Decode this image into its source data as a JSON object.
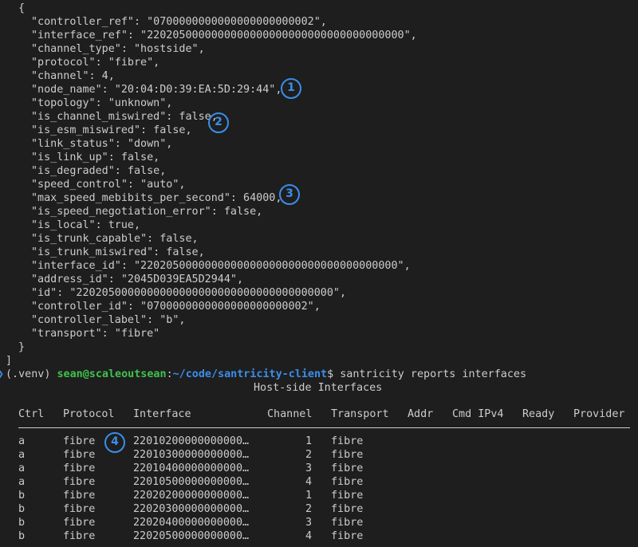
{
  "json_output": {
    "open_bracket": "{",
    "lines": [
      "\"controller_ref\": \"0700000000000000000000002\",",
      "\"interface_ref\": \"2202050000000000000000000000000000000000\",",
      "\"channel_type\": \"hostside\",",
      "\"protocol\": \"fibre\",",
      "\"channel\": 4,",
      "\"node_name\": \"20:04:D0:39:EA:5D:29:44\",",
      "\"topology\": \"unknown\",",
      "\"is_channel_miswired\": false,",
      "\"is_esm_miswired\": false,",
      "\"link_status\": \"down\",",
      "\"is_link_up\": false,",
      "\"is_degraded\": false,",
      "\"speed_control\": \"auto\",",
      "\"max_speed_mebibits_per_second\": 64000,",
      "\"is_speed_negotiation_error\": false,",
      "\"is_local\": true,",
      "\"is_trunk_capable\": false,",
      "\"is_trunk_miswired\": false,",
      "\"interface_id\": \"2202050000000000000000000000000000000000\",",
      "\"address_id\": \"2045D039EA5D2944\",",
      "\"id\": \"2202050000000000000000000000000000000000\",",
      "\"controller_id\": \"0700000000000000000000002\",",
      "\"controller_label\": \"b\",",
      "\"transport\": \"fibre\""
    ],
    "close_brace": "}",
    "close_bracket": "]"
  },
  "prompt": {
    "venv": "(.venv) ",
    "user_host": "sean@scaleoutsean",
    "sep": ":",
    "path": "~/code/santricity-client",
    "symbol": "$ ",
    "command": "santricity reports interfaces"
  },
  "report": {
    "title": "Host-side Interfaces",
    "columns": [
      "Ctrl",
      "Protocol",
      "Interface",
      "Channel",
      "Transport",
      "Addr",
      "Cmd IPv4",
      "Ready",
      "Provider"
    ],
    "rows": [
      [
        "a",
        "fibre",
        "22010200000000000…",
        "1",
        "fibre"
      ],
      [
        "a",
        "fibre",
        "22010300000000000…",
        "2",
        "fibre"
      ],
      [
        "a",
        "fibre",
        "22010400000000000…",
        "3",
        "fibre"
      ],
      [
        "a",
        "fibre",
        "22010500000000000…",
        "4",
        "fibre"
      ],
      [
        "b",
        "fibre",
        "22020200000000000…",
        "1",
        "fibre"
      ],
      [
        "b",
        "fibre",
        "22020300000000000…",
        "2",
        "fibre"
      ],
      [
        "b",
        "fibre",
        "22020400000000000…",
        "3",
        "fibre"
      ],
      [
        "b",
        "fibre",
        "22020500000000000…",
        "4",
        "fibre"
      ]
    ]
  },
  "annotations": [
    "1",
    "2",
    "3",
    "4"
  ],
  "colors": {
    "background": "#1e1e1e",
    "text": "#cccccc",
    "user": "#3fc24c",
    "path": "#3b8eea",
    "marker": "#3b8eea"
  }
}
